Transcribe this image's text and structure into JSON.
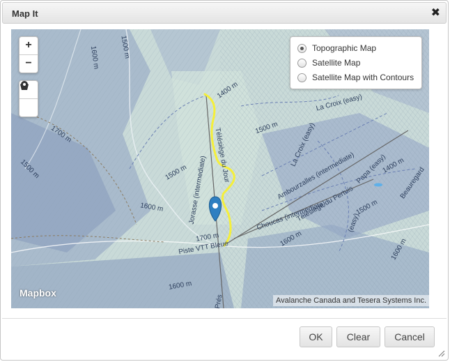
{
  "dialog": {
    "title": "Map It",
    "close_glyph": "✖"
  },
  "map": {
    "zoom_in": "+",
    "zoom_out": "−",
    "tools": [
      "polygon-icon",
      "marker-icon"
    ],
    "layers": [
      {
        "label": "Topographic Map",
        "selected": true
      },
      {
        "label": "Satellite Map",
        "selected": false
      },
      {
        "label": "Satellite Map with Contours",
        "selected": false
      }
    ],
    "logo": "Mapbox",
    "attribution": "Avalanche Canada and Tesera Systems Inc.",
    "contour_labels": [
      "1500 m",
      "1600 m",
      "1700 m",
      "1400 m",
      "1500 m",
      "1600 m",
      "1500 m",
      "1700 m",
      "1600 m",
      "1400 m",
      "1500 m",
      "1600 m",
      "1600 m",
      "1500 m"
    ],
    "trail_labels": [
      "La Croix (easy)",
      "La Croix (easy)",
      "Ambourzalles (intermediate)",
      "Télésiège du Pertuis",
      "Papa (easy)",
      "Beauregard",
      "Choucas (intermediate)",
      "Jorasse (intermediate)",
      "Télésiège du Jour",
      "Piste VTT Bleue",
      "(easy)",
      "Prés"
    ],
    "colors": {
      "track": "#f5ef3a",
      "marker": "#2e7fc1"
    }
  },
  "footer": {
    "ok": "OK",
    "clear": "Clear",
    "cancel": "Cancel"
  }
}
